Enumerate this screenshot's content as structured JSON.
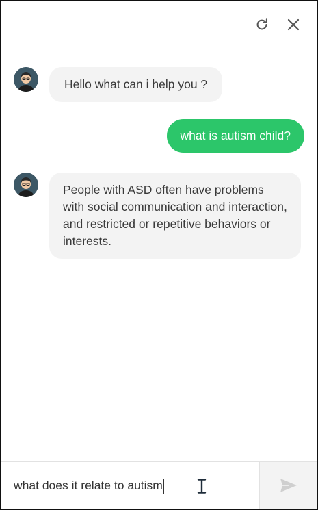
{
  "header": {
    "refresh_icon": "refresh-icon",
    "close_icon": "close-icon"
  },
  "messages": [
    {
      "sender": "bot",
      "avatar_icon": "bot-avatar-icon",
      "text": "Hello what can i help you ?"
    },
    {
      "sender": "user",
      "text": "what is autism child?"
    },
    {
      "sender": "bot",
      "avatar_icon": "bot-avatar-icon",
      "text": "People with ASD often have problems with social communication and interaction, and restricted or repetitive behaviors or interests."
    }
  ],
  "composer": {
    "value": "what does it relate to autism",
    "send_icon": "send-icon"
  },
  "colors": {
    "user_bubble": "#2cc66a",
    "bot_bubble": "#f3f3f3",
    "icon": "#555555",
    "send_icon": "#cfcfcf"
  }
}
